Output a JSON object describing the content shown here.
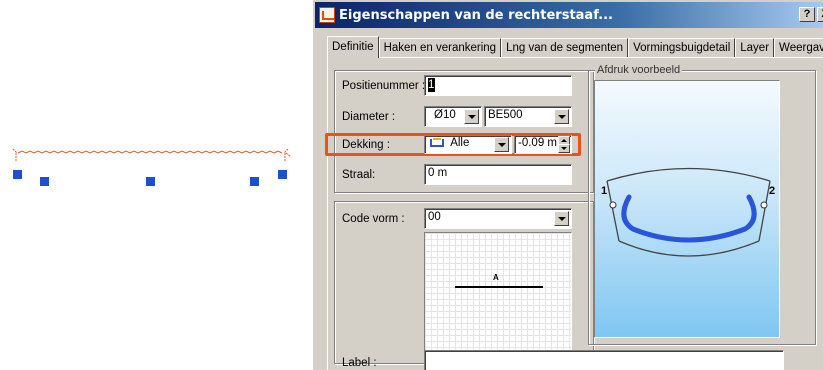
{
  "dialog": {
    "title": "Eigenschappen van de rechterstaaf...",
    "help_label": "?",
    "close_label": "X"
  },
  "tabs": [
    {
      "label": "Definitie",
      "active": true
    },
    {
      "label": "Haken en verankering",
      "active": false
    },
    {
      "label": "Lng van de segmenten",
      "active": false
    },
    {
      "label": "Vormingsbuigdetail",
      "active": false
    },
    {
      "label": "Layer",
      "active": false
    },
    {
      "label": "Weergave",
      "active": false
    }
  ],
  "form": {
    "positie_label": "Positienummer :",
    "positie_value": "1",
    "diameter_label": "Diameter :",
    "diameter_value": "Ø10",
    "staal_value": "BE500",
    "dekking_label": "Dekking :",
    "dekking_value": "Alle",
    "dekking_offset": "-0.09 m",
    "straal_label": "Straal:",
    "straal_value": "0 m",
    "code_vorm_label": "Code vorm :",
    "code_vorm_value": "00",
    "shape_segment_label": "A",
    "label_label": "Label :",
    "label_value": ""
  },
  "preview": {
    "legend": "Afdruk voorbeeld",
    "end_1": "1",
    "end_2": "2"
  },
  "colors": {
    "highlight": "#e8531c",
    "bar_blue": "#2a55d8",
    "grip_blue": "#1f4fd0",
    "cad_red": "#e05a2a"
  }
}
